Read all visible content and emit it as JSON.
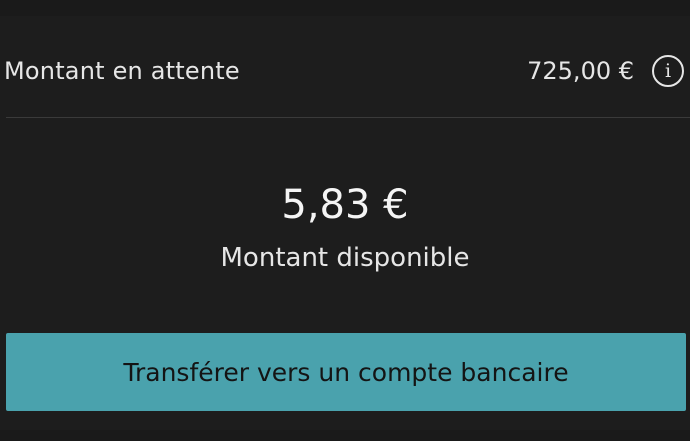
{
  "pending": {
    "label": "Montant en attente",
    "amount": "725,00 €",
    "info_glyph": "i",
    "info_icon": "info-circle-icon"
  },
  "balance": {
    "amount": "5,83 €",
    "label": "Montant disponible"
  },
  "actions": {
    "transfer_label": "Transférer vers un compte bancaire"
  },
  "colors": {
    "background": "#1d1d1d",
    "accent": "#4aa2ad",
    "text": "#e6e6e6",
    "button_text": "#141414"
  }
}
